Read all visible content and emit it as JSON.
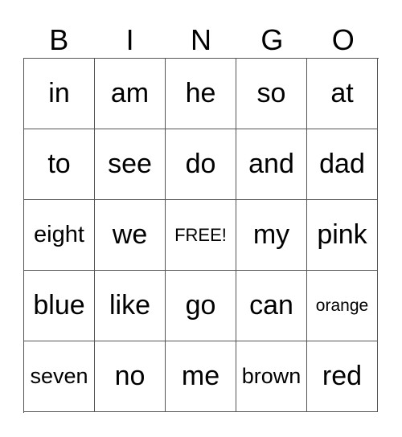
{
  "header": [
    "B",
    "I",
    "N",
    "G",
    "O"
  ],
  "cells": [
    [
      "in",
      "am",
      "he",
      "so",
      "at"
    ],
    [
      "to",
      "see",
      "do",
      "and",
      "dad"
    ],
    [
      "eight",
      "we",
      "FREE!",
      "my",
      "pink"
    ],
    [
      "blue",
      "like",
      "go",
      "can",
      "orange"
    ],
    [
      "seven",
      "no",
      "me",
      "brown",
      "red"
    ]
  ]
}
